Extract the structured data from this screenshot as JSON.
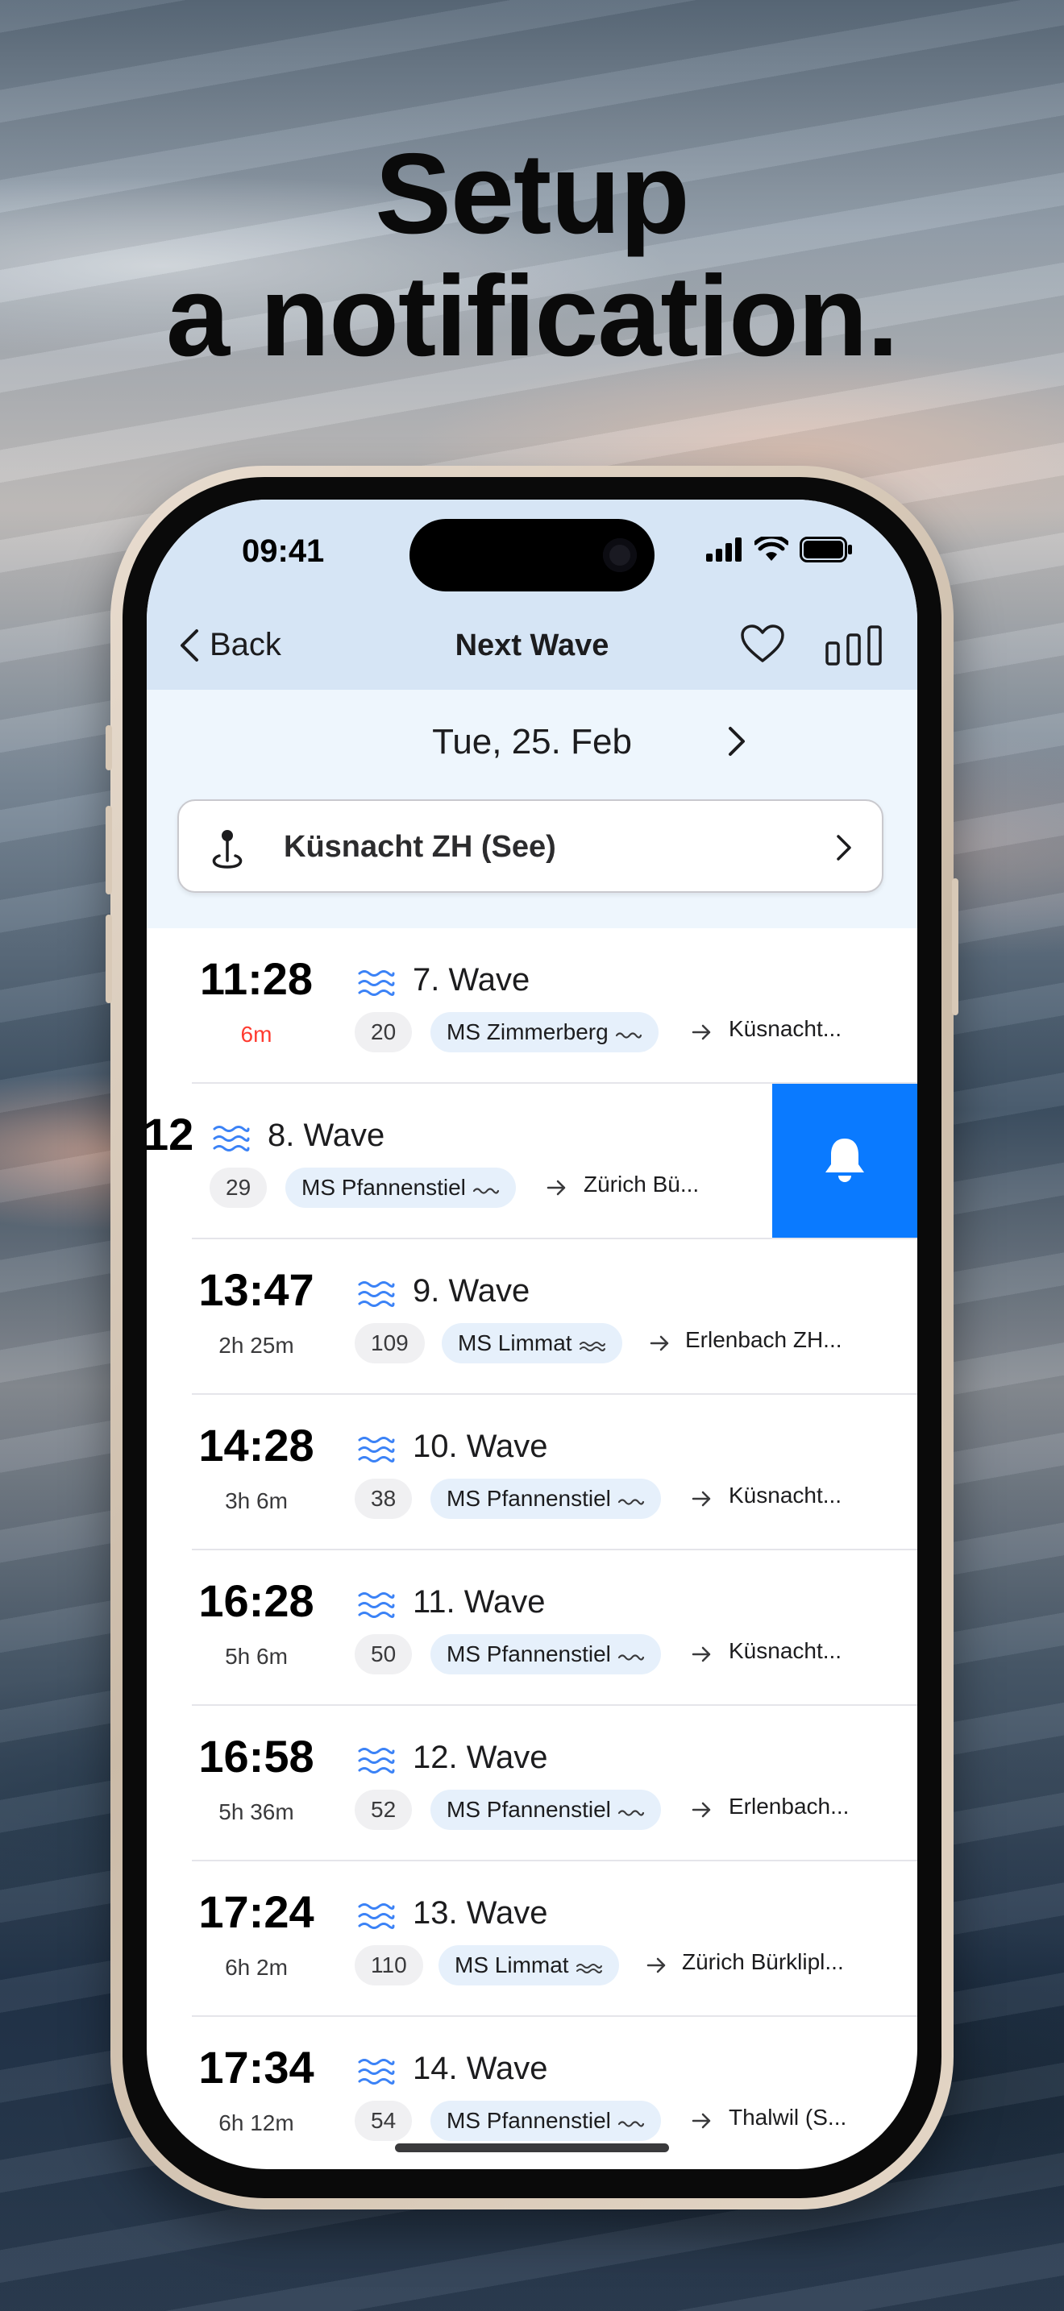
{
  "headline": {
    "line1": "Setup",
    "line2": "a notification."
  },
  "status_bar": {
    "time": "09:41"
  },
  "nav": {
    "back_label": "Back",
    "title": "Next Wave"
  },
  "filter": {
    "date": "Tue, 25. Feb",
    "station": "Küsnacht ZH (See)"
  },
  "rows": [
    {
      "time": "11:28",
      "duration": "6m",
      "wave": "7. Wave",
      "course": "20",
      "ship": "MS Zimmerberg",
      "destination": "Küsnacht..."
    },
    {
      "time": "12",
      "duration": "",
      "wave": "8. Wave",
      "course": "29",
      "ship": "MS Pfannenstiel",
      "destination": "Zürich Bü..."
    },
    {
      "time": "13:47",
      "duration": "2h 25m",
      "wave": "9. Wave",
      "course": "109",
      "ship": "MS Limmat",
      "destination": "Erlenbach ZH..."
    },
    {
      "time": "14:28",
      "duration": "3h 6m",
      "wave": "10. Wave",
      "course": "38",
      "ship": "MS Pfannenstiel",
      "destination": "Küsnacht..."
    },
    {
      "time": "16:28",
      "duration": "5h 6m",
      "wave": "11. Wave",
      "course": "50",
      "ship": "MS Pfannenstiel",
      "destination": "Küsnacht..."
    },
    {
      "time": "16:58",
      "duration": "5h 36m",
      "wave": "12. Wave",
      "course": "52",
      "ship": "MS Pfannenstiel",
      "destination": "Erlenbach..."
    },
    {
      "time": "17:24",
      "duration": "6h 2m",
      "wave": "13. Wave",
      "course": "110",
      "ship": "MS Limmat",
      "destination": "Zürich Bürklipl..."
    },
    {
      "time": "17:34",
      "duration": "6h 12m",
      "wave": "14. Wave",
      "course": "54",
      "ship": "MS Pfannenstiel",
      "destination": "Thalwil (S..."
    }
  ],
  "colors": {
    "accent": "#0a7aff",
    "wave_icon": "#3b82f6",
    "countdown_soon": "#ff3b30",
    "header_bg": "#d6e5f5"
  }
}
